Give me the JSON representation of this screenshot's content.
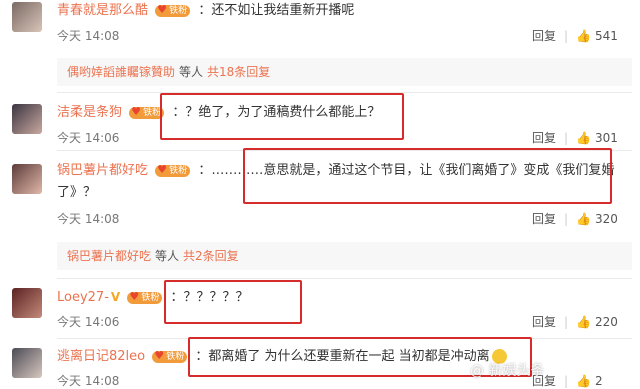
{
  "comments": [
    {
      "user": "青春就是那么酷",
      "badge": "铁粉",
      "text": "：还不如让我结重新开播呢",
      "time": "今天 14:08",
      "reply": "回复",
      "likes": "541"
    },
    {
      "user": "洁柔是条狗",
      "badge": "铁粉",
      "text": "：？绝了，为了通稿费什么都能上？",
      "time": "今天 14:06",
      "reply": "回复",
      "likes": "301"
    },
    {
      "user": "锅巴薯片都好吃",
      "badge": "铁粉",
      "text": "：…………意思就是，通过这个节目，让《我们离婚了》变成《我们复婚",
      "text2": "了》？",
      "time": "今天 14:08",
      "reply": "回复",
      "likes": "320"
    },
    {
      "user": "Loey27-",
      "badge": "铁粉",
      "text": "：？？？？？",
      "time": "今天 14:06",
      "reply": "回复",
      "likes": "220"
    },
    {
      "user": "逃离日记82leo",
      "badge": "铁粉",
      "text": "：都离婚了 为什么还要重新在一起 当初都是冲动离",
      "time": "今天 14:08",
      "reply": "回复",
      "likes": "2"
    }
  ],
  "sub_threads": [
    {
      "user": "偶哟婞謟誰矚镓贊助",
      "suffix": "等人",
      "count": "共18条回复"
    },
    {
      "user": "锅巴薯片都好吃",
      "suffix": "等人",
      "count": "共2条回复"
    }
  ],
  "icons": {
    "like": "thumbs-up-icon",
    "fan_heart": "heart-icon",
    "emoji": "confused-face-icon"
  },
  "watermark": "@ 新娱头条"
}
